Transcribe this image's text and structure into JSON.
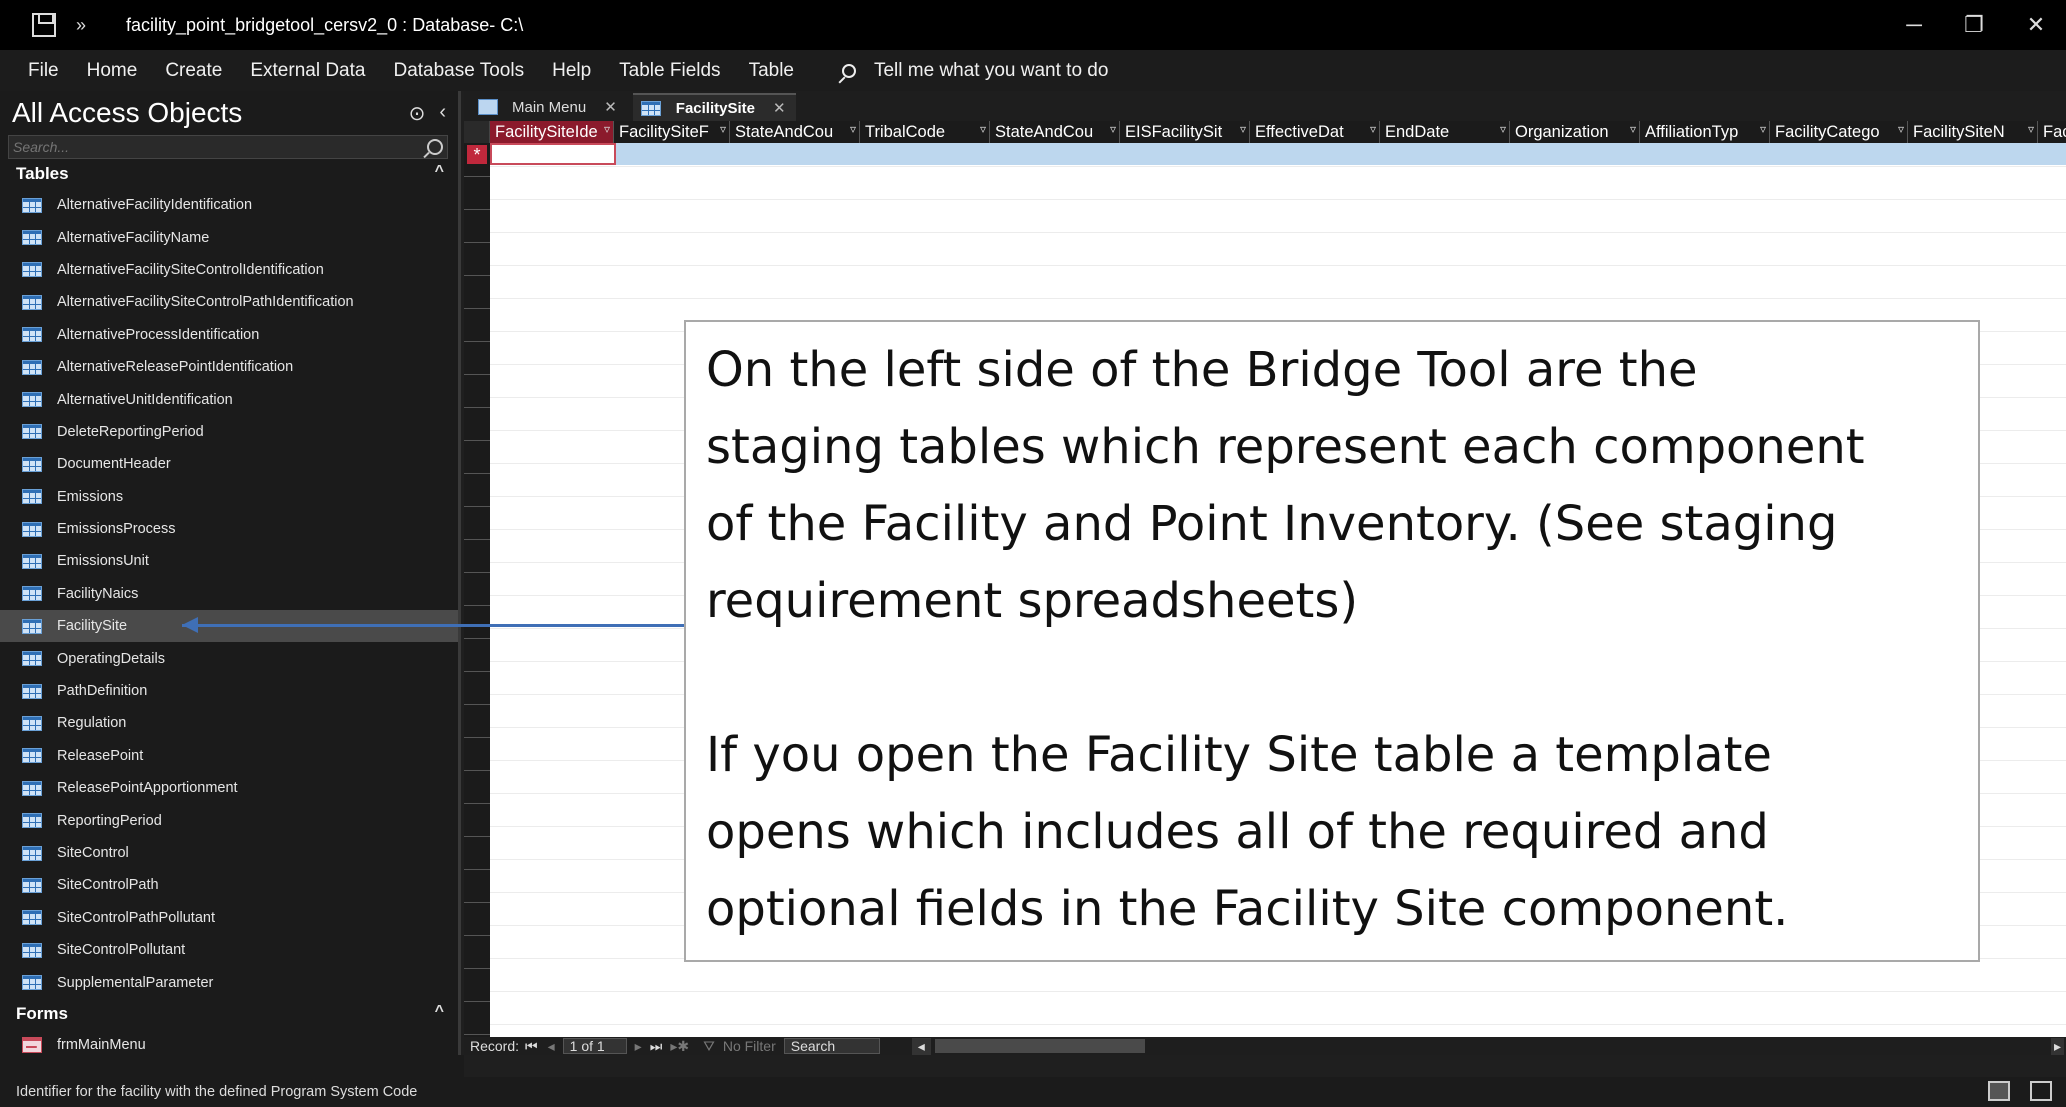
{
  "window": {
    "title": "facility_point_bridgetool_cersv2_0 : Database- C:\\",
    "more_glyph": "»",
    "minimize": "─",
    "restore": "❐",
    "close": "✕"
  },
  "menu": {
    "items": [
      "File",
      "Home",
      "Create",
      "External Data",
      "Database Tools",
      "Help",
      "Table Fields",
      "Table"
    ],
    "tell": "Tell me what you want to do"
  },
  "nav": {
    "title": "All Access Objects",
    "search_placeholder": "Search...",
    "tables_group": "Tables",
    "tables": [
      "AlternativeFacilityIdentification",
      "AlternativeFacilityName",
      "AlternativeFacilitySiteControlIdentification",
      "AlternativeFacilitySiteControlPathIdentification",
      "AlternativeProcessIdentification",
      "AlternativeReleasePointIdentification",
      "AlternativeUnitIdentification",
      "DeleteReportingPeriod",
      "DocumentHeader",
      "Emissions",
      "EmissionsProcess",
      "EmissionsUnit",
      "FacilityNaics",
      "FacilitySite",
      "OperatingDetails",
      "PathDefinition",
      "Regulation",
      "ReleasePoint",
      "ReleasePointApportionment",
      "ReportingPeriod",
      "SiteControl",
      "SiteControlPath",
      "SiteControlPathPollutant",
      "SiteControlPollutant",
      "SupplementalParameter"
    ],
    "selected_table": "FacilitySite",
    "forms_group": "Forms",
    "forms": [
      "frmMainMenu"
    ]
  },
  "tabs": [
    {
      "label": "Main Menu",
      "active": false
    },
    {
      "label": "FacilitySite",
      "active": true
    }
  ],
  "grid": {
    "columns": [
      "FacilitySiteIde",
      "FacilitySiteF",
      "StateAndCou",
      "TribalCode",
      "StateAndCou",
      "EISFacilitySit",
      "EffectiveDat",
      "EndDate",
      "Organization",
      "AffiliationTyp",
      "FacilityCatego",
      "FacilitySiteN",
      "Fac"
    ],
    "new_row_marker": "*"
  },
  "record_nav": {
    "label": "Record:",
    "position": "1 of 1",
    "filter": "No Filter",
    "search": "Search"
  },
  "callout": {
    "paragraph1_lines": [
      "On the left side of the Bridge Tool are the",
      "staging tables which represent each component",
      "of the Facility and Point Inventory. (See staging",
      "requirement spreadsheets)"
    ],
    "paragraph2_lines": [
      "If you open the Facility Site table a template",
      "opens which includes all of the required and",
      "optional fields in the Facility Site component."
    ]
  },
  "status": {
    "text": "Identifier for the facility with the defined Program System Code"
  }
}
